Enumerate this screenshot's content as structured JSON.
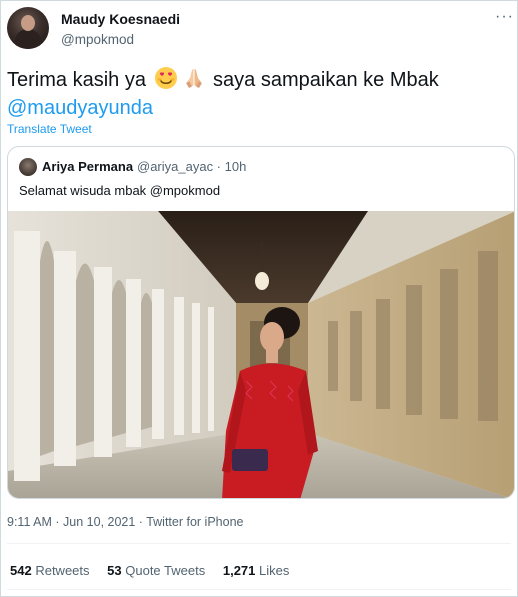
{
  "tweet": {
    "author_name": "Maudy Koesnaedi",
    "author_handle": "@mpokmod",
    "more_glyph": "···",
    "text_before_emoji": "Terima kasih ya ",
    "emoji_1": "smiling-face-with-heart-eyes",
    "emoji_2": "folded-hands",
    "text_after_emoji": " saya sampaikan ke Mbak",
    "mention": "@maudyayunda",
    "translate_label": "Translate Tweet",
    "timestamp": "9:11 AM · Jun 10, 2021 · Twitter for iPhone"
  },
  "quoted_tweet": {
    "author_name": "Ariya Permana",
    "meta": "@ariya_ayac · 10h",
    "text": "Selamat wisuda mbak @mpokmod"
  },
  "stats": {
    "retweets_count": "542",
    "retweets_label": "Retweets",
    "quote_count": "53",
    "quote_label": "Quote Tweets",
    "likes_count": "1,271",
    "likes_label": "Likes"
  },
  "colors": {
    "accent": "#1d9bf0",
    "text": "#0f1419",
    "secondary": "#536471",
    "border": "#cfd9de",
    "dress": "#c81c22"
  }
}
